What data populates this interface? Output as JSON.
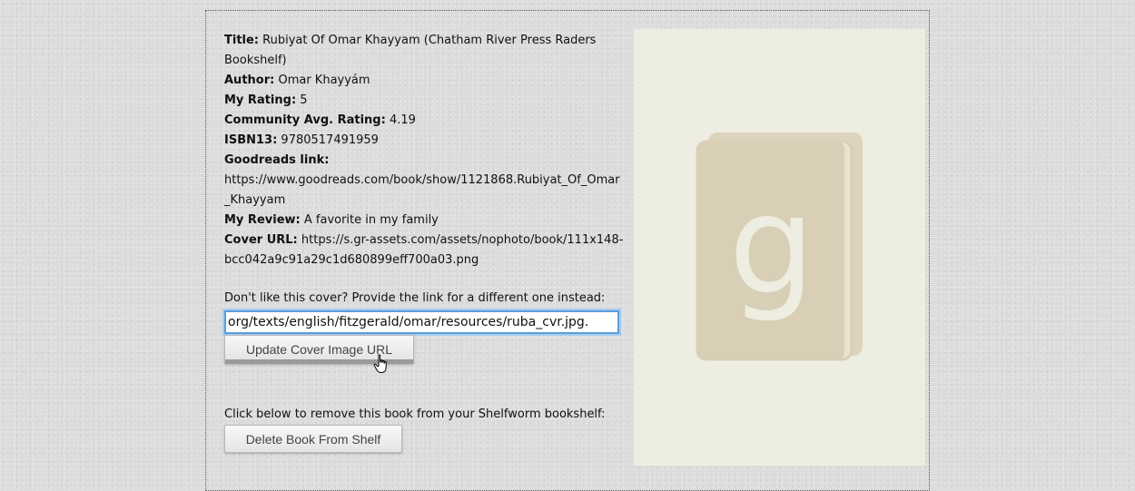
{
  "book": {
    "title_label": "Title:",
    "title_value": "Rubiyat Of Omar Khayyam (Chatham River Press Raders Bookshelf)",
    "author_label": "Author:",
    "author_value": "Omar Khayyám",
    "my_rating_label": "My Rating:",
    "my_rating_value": "5",
    "community_rating_label": "Community Avg. Rating:",
    "community_rating_value": "4.19",
    "isbn_label": "ISBN13:",
    "isbn_value": "9780517491959",
    "goodreads_label": "Goodreads link:",
    "goodreads_value": "https://www.goodreads.com/book/show/1121868.Rubiyat_Of_Omar_Khayyam",
    "review_label": "My Review:",
    "review_value": "A favorite in my family",
    "cover_url_label": "Cover URL:",
    "cover_url_value": "https://s.gr-assets.com/assets/nophoto/book/111x148-bcc042a9c91a29c1d680899eff700a03.png"
  },
  "cover_form": {
    "prompt": "Don't like this cover? Provide the link for a different one instead:",
    "input_value": ".org/texts/english/fitzgerald/omar/resources/ruba_cvr.jpg",
    "update_button": "Update Cover Image URL"
  },
  "remove_section": {
    "prompt": "Click below to remove this book from your Shelfworm bookshelf:",
    "delete_button": "Delete Book From Shelf"
  },
  "cover_image": {
    "icon": "goodreads-placeholder-icon",
    "letter": "g",
    "background_color": "#eeede1",
    "book_color": "#d9cfb6"
  }
}
